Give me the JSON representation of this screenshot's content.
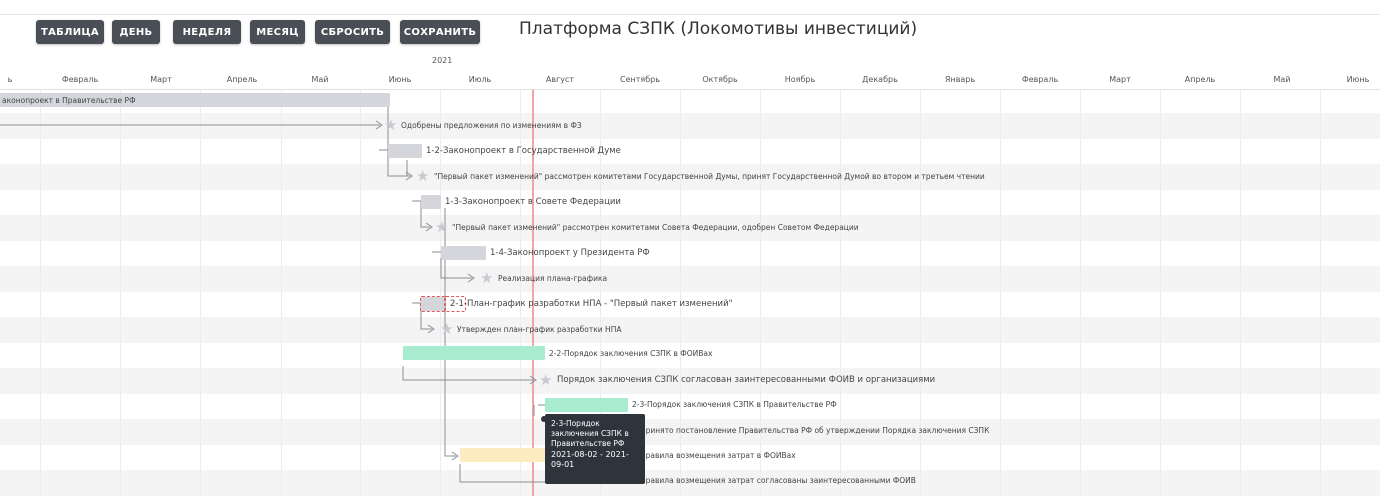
{
  "toolbar": {
    "buttons": [
      "ТАБЛИЦА",
      "ДЕНЬ",
      "НЕДЕЛЯ",
      "МЕСЯЦ",
      "СБРОСИТЬ",
      "СОХРАНИТЬ"
    ],
    "title": "Платформа СЗПК (Локомотивы инвестиций)",
    "button_color": "#4a4f57"
  },
  "timeline": {
    "year": "2021",
    "months": [
      "ь",
      "Февраль",
      "Март",
      "Апрель",
      "Май",
      "Июнь",
      "Июль",
      "Август",
      "Сентябрь",
      "Октябрь",
      "Ноябрь",
      "Декабрь",
      "Январь",
      "Февраль",
      "Март",
      "Апрель",
      "Май",
      "Июнь"
    ]
  },
  "tasks": [
    {
      "type": "bar",
      "label": "аконопроект в Правительстве РФ",
      "color": "gray"
    },
    {
      "type": "milestone",
      "label": "Одобрены предложения по изменениям в ФЗ"
    },
    {
      "type": "bar",
      "label": "1-2-Законопроект в Государственной Думе",
      "color": "gray"
    },
    {
      "type": "milestone",
      "label": "\"Первый пакет изменений\" рассмотрен комитетами Государственной Думы, принят Государственной Думой во втором и третьем чтении"
    },
    {
      "type": "bar",
      "label": "1-3-Законопроект в Совете Федерации",
      "color": "gray"
    },
    {
      "type": "milestone",
      "label": "\"Первый пакет изменений\" рассмотрен комитетами Совета Федерации, одобрен Советом Федерации"
    },
    {
      "type": "bar",
      "label": "1-4-Законопроект у Президента РФ",
      "color": "gray"
    },
    {
      "type": "milestone",
      "label": "Реализация плана-графика"
    },
    {
      "type": "bar",
      "label": "2-1-План-график разработки НПА - \"Первый пакет изменений\"",
      "color": "dashed"
    },
    {
      "type": "milestone",
      "label": "Утвержден план-график разработки НПА"
    },
    {
      "type": "bar",
      "label": "2-2-Порядок заключения СЗПК в ФОИВах",
      "color": "green"
    },
    {
      "type": "milestone",
      "label": "Порядок заключения СЗПК согласован заинтересованными ФОИВ и организациями"
    },
    {
      "type": "bar",
      "label": "2-3-Порядок заключения СЗПК в Правительстве РФ",
      "color": "green"
    },
    {
      "type": "milestone",
      "label": "Принято постановление Правительства РФ об утверждении Порядка заключения СЗПК"
    },
    {
      "type": "bar",
      "label": "Правила возмещения затрат в ФОИВах",
      "color": "yellow"
    },
    {
      "type": "milestone",
      "label": "Правила возмещения затрат согласованы заинтересованными ФОИВ"
    }
  ],
  "tooltip": {
    "title": "2-3-Порядок заключения СЗПК в Правительстве РФ",
    "dates": "2021-08-02 - 2021-09-01"
  },
  "colors": {
    "gray_bar": "#d4d6dc",
    "green_bar": "#a8ecd0",
    "yellow_bar": "#fdecbf",
    "today_line": "#f2a3a3"
  }
}
